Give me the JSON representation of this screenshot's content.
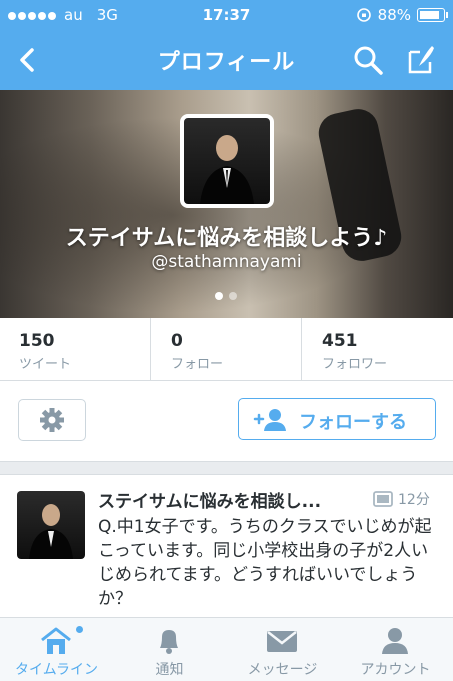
{
  "status_bar": {
    "carrier": "au",
    "network": "3G",
    "time": "17:37",
    "battery": "88%"
  },
  "nav": {
    "title": "プロフィール"
  },
  "profile": {
    "name": "ステイサムに悩みを相談しよう♪",
    "handle": "@stathamnayami",
    "pages": 2,
    "current_page": 1
  },
  "stats": [
    {
      "value": "150",
      "label": "ツイート"
    },
    {
      "value": "0",
      "label": "フォロー"
    },
    {
      "value": "451",
      "label": "フォロワー"
    }
  ],
  "actions": {
    "follow_label": "フォローする"
  },
  "tweet": {
    "name": "ステイサムに悩みを相談し...",
    "time": "12分",
    "text": "Q.中1女子です。うちのクラスでいじめが起こっています。同じ小学校出身の子が2人いじめられてます。どうすればいいでしょうか？"
  },
  "tabbar": [
    {
      "label": "タイムライン",
      "icon": "home-icon"
    },
    {
      "label": "通知",
      "icon": "bell-icon"
    },
    {
      "label": "メッセージ",
      "icon": "envelope-icon"
    },
    {
      "label": "アカウント",
      "icon": "person-icon"
    }
  ],
  "colors": {
    "accent": "#55acee",
    "text": "#292f33",
    "muted": "#8899a6"
  }
}
